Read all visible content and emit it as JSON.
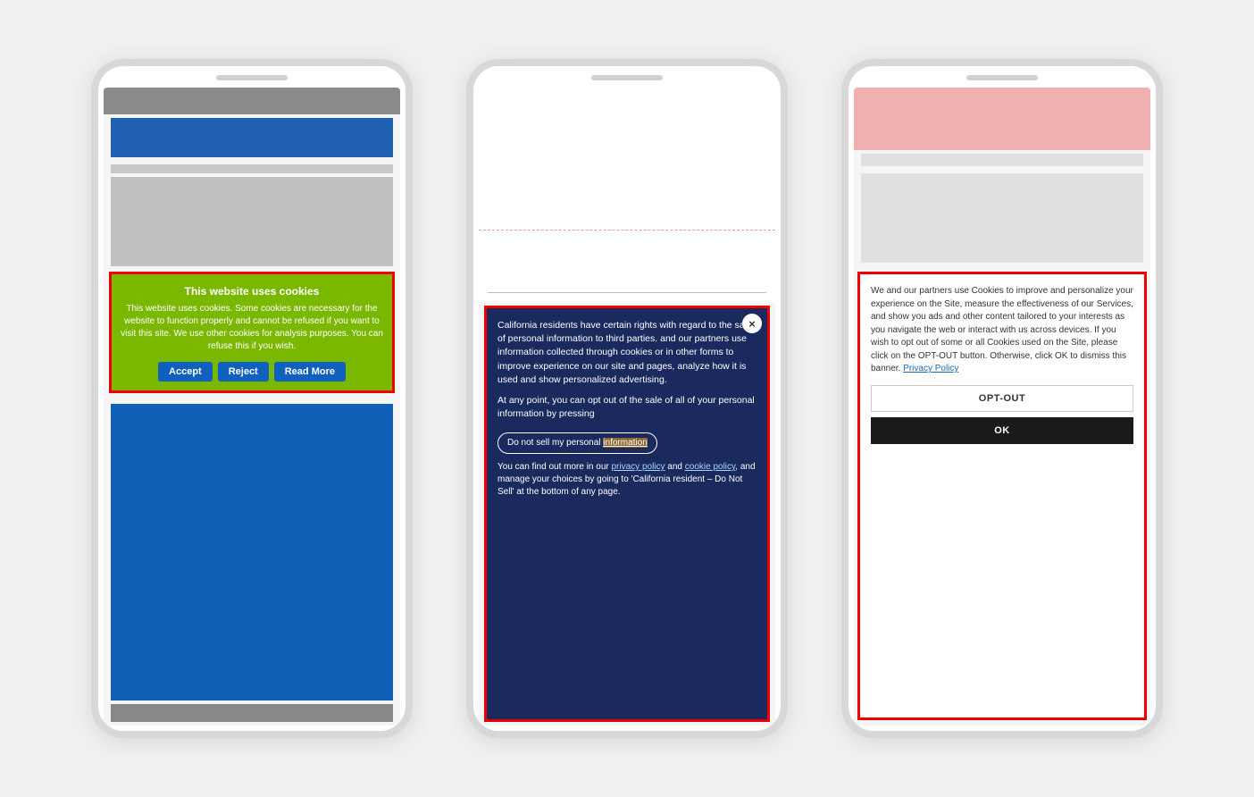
{
  "phone1": {
    "cookie_banner": {
      "title": "This website uses cookies",
      "text": "This website uses cookies. Some cookies are necessary for the website to function properly and cannot be refused if you want to visit this site. We use other cookies for analysis purposes. You can refuse this if you wish.",
      "btn_accept": "Accept",
      "btn_reject": "Reject",
      "btn_read_more": "Read More"
    }
  },
  "phone2": {
    "cookie_banner": {
      "close_label": "×",
      "text1": "California residents have certain rights with regard to the sale of personal information to third parties.",
      "text2": "and our partners use information collected through cookies or in other forms to improve experience on our site and pages, analyze how it is used and show personalized advertising.",
      "text3": "At any point, you can opt out of the sale of all of your personal information by pressing",
      "opt_out_btn": "Do not sell my personal information",
      "text4": "You can find out more in our",
      "link1": "privacy policy",
      "text5": "and",
      "link2": "cookie policy",
      "text6": ", and manage your choices by going to 'California resident – Do Not Sell' at the bottom of any page."
    }
  },
  "phone3": {
    "cookie_banner": {
      "text": "We and our partners use Cookies to improve and personalize your experience on the Site, measure the effectiveness of our Services, and show you ads and other content tailored to your interests as you navigate the web or interact with us across devices. If you wish to opt out of some or all Cookies used on the Site, please click on the OPT-OUT button. Otherwise, click OK to dismiss this banner.",
      "privacy_policy_link": "Privacy Policy",
      "btn_optout": "OPT-OUT",
      "btn_ok": "OK"
    }
  }
}
